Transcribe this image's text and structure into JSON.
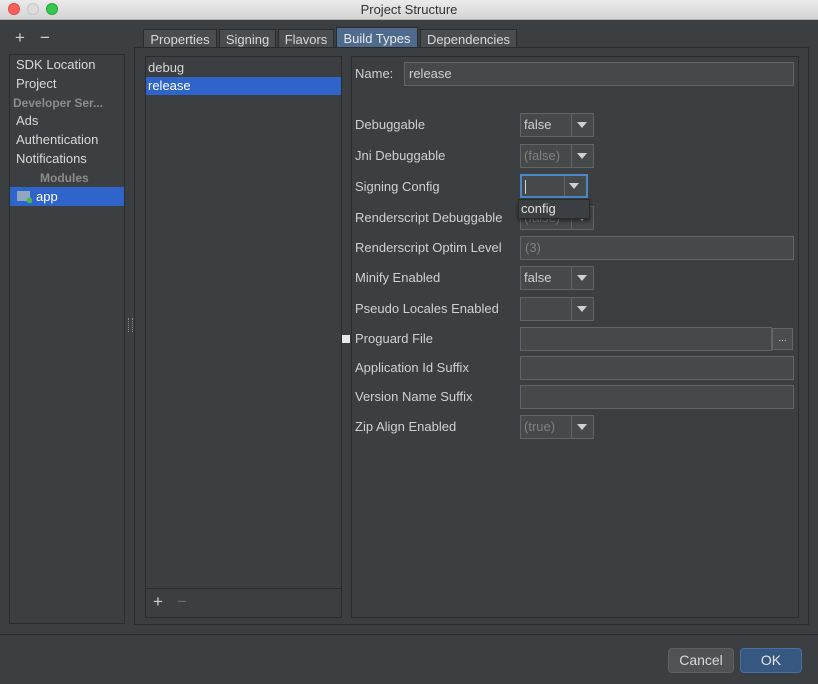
{
  "window": {
    "title": "Project Structure"
  },
  "left_toolbar": {
    "add": "+",
    "remove": "−"
  },
  "nav": {
    "items": [
      "SDK Location",
      "Project"
    ],
    "developer_services_header": "Developer Ser...",
    "services": [
      "Ads",
      "Authentication",
      "Notifications"
    ],
    "modules_header": "Modules",
    "module": "app"
  },
  "tabs": [
    "Properties",
    "Signing",
    "Flavors",
    "Build Types",
    "Dependencies"
  ],
  "build_types": {
    "items": [
      "debug",
      "release"
    ],
    "selected": "release",
    "add": "+",
    "remove": "−"
  },
  "form": {
    "name_label": "Name:",
    "name_value": "release",
    "debuggable_label": "Debuggable",
    "debuggable_value": "false",
    "jni_label": "Jni Debuggable",
    "jni_value": "(false)",
    "signing_label": "Signing Config",
    "signing_value": "",
    "signing_popup_option": "config",
    "rs_debug_label": "Renderscript Debuggable",
    "rs_debug_value": "(false)",
    "rs_optim_label": "Renderscript Optim Level",
    "rs_optim_value": "(3)",
    "minify_label": "Minify Enabled",
    "minify_value": "false",
    "pseudo_label": "Pseudo Locales Enabled",
    "pseudo_value": "",
    "proguard_label": "Proguard File",
    "proguard_value": "",
    "browse_label": "...",
    "appid_label": "Application Id Suffix",
    "appid_value": "",
    "version_label": "Version Name Suffix",
    "version_value": "",
    "zip_label": "Zip Align Enabled",
    "zip_value": "(true)"
  },
  "buttons": {
    "cancel": "Cancel",
    "ok": "OK"
  }
}
